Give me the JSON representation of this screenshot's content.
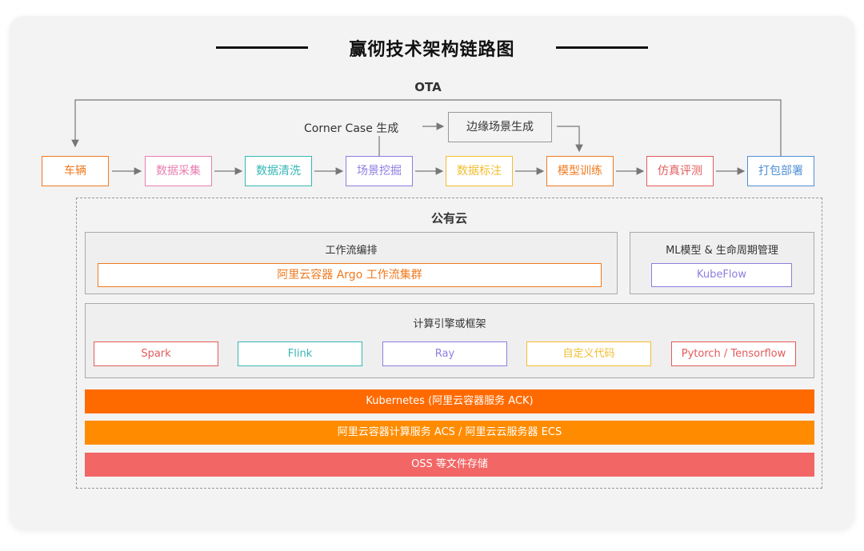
{
  "title": "赢彻技术架构链路图",
  "ota_label": "OTA",
  "corner_case_label": "Corner Case 生成",
  "edge_scene_label": "边缘场景生成",
  "pipeline": [
    {
      "label": "车辆",
      "color": "#f07a1e"
    },
    {
      "label": "数据采集",
      "color": "#e77fb1"
    },
    {
      "label": "数据清洗",
      "color": "#36b7b5"
    },
    {
      "label": "场景挖掘",
      "color": "#8d7ee0"
    },
    {
      "label": "数据标注",
      "color": "#f2bd2e"
    },
    {
      "label": "模型训练",
      "color": "#f07a1e"
    },
    {
      "label": "仿真评测",
      "color": "#e25b5b"
    },
    {
      "label": "打包部署",
      "color": "#4f8fd6"
    }
  ],
  "cloud_label": "公有云",
  "workflow": {
    "title": "工作流编排",
    "cluster_label": "阿里云容器 Argo 工作流集群",
    "cluster_color": "#f07a1e"
  },
  "ml": {
    "title": "ML模型 & 生命周期管理",
    "kubeflow_label": "KubeFlow",
    "kubeflow_color": "#8d7ee0"
  },
  "compute": {
    "title": "计算引擎或框架",
    "engines": [
      {
        "label": "Spark",
        "color": "#e25b5b"
      },
      {
        "label": "Flink",
        "color": "#36b7b5"
      },
      {
        "label": "Ray",
        "color": "#8d7ee0"
      },
      {
        "label": "自定义代码",
        "color": "#f2bd2e"
      },
      {
        "label": "Pytorch / Tensorflow",
        "color": "#e25b5b"
      }
    ]
  },
  "bars": [
    {
      "label": "Kubernetes (阿里云容器服务 ACK)",
      "color": "#ff6a00"
    },
    {
      "label": "阿里云容器计算服务 ACS / 阿里云云服务器 ECS",
      "color": "#ff8c00"
    },
    {
      "label": "OSS 等文件存储",
      "color": "#f26666"
    }
  ]
}
